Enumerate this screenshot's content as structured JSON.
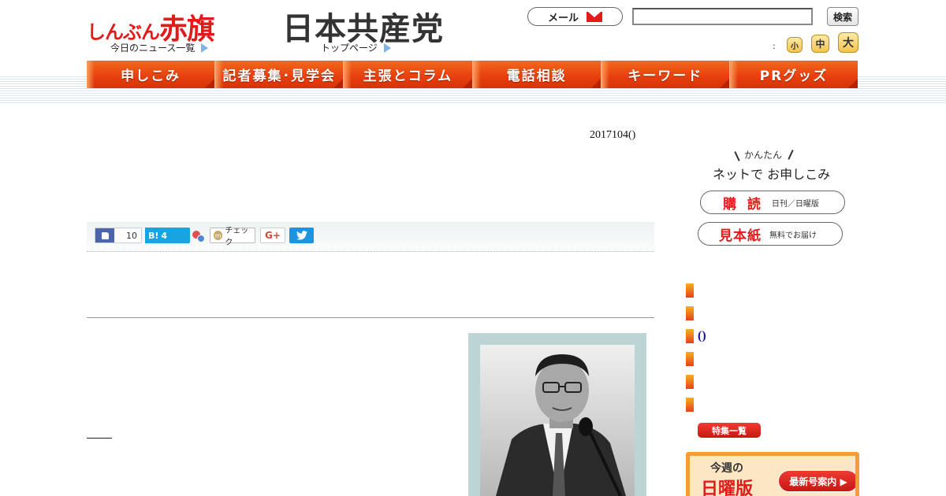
{
  "header": {
    "akahata_logo_small": "しんぶん",
    "akahata_logo_big": "赤旗",
    "news_list_link": "今日のニュース一覧",
    "jcp_logo": "日本共産党",
    "top_page_link": "トップページ",
    "mail_label": "メール",
    "search_value": "",
    "search_button": "検索",
    "font_size_label": ":",
    "font_small": "小",
    "font_medium": "中",
    "font_large": "大"
  },
  "nav": {
    "items": [
      {
        "label": "申しこみ"
      },
      {
        "label": "記者募集･見学会"
      },
      {
        "label": "主張とコラム"
      },
      {
        "label": "電話相談"
      },
      {
        "label": "キーワード"
      },
      {
        "label": "PRグッズ"
      }
    ]
  },
  "article": {
    "date": "2017104()"
  },
  "share": {
    "facebook_count": "10",
    "hatena_label": "B!",
    "hatena_count": "4",
    "mixi_label": "チェック",
    "gplus_label": "G+"
  },
  "sidebar": {
    "kantan": "かんたん",
    "net_apply": "ネットで  お申しこみ",
    "subscribe_big": "購 読",
    "subscribe_small": "日刊／日曜版",
    "sample_big": "見本紙",
    "sample_small": "無料でお届け",
    "paren_item": "()",
    "tokushu_button": "特集一覧",
    "sunday_konshu": "今週の",
    "sunday_title": "日曜版",
    "latest_issue_button": "最新号案内 ▶"
  },
  "colors": {
    "brand_red": "#e21a1a",
    "nav_orange": "#e8410f",
    "sidebar_link_blue": "#16169c"
  }
}
